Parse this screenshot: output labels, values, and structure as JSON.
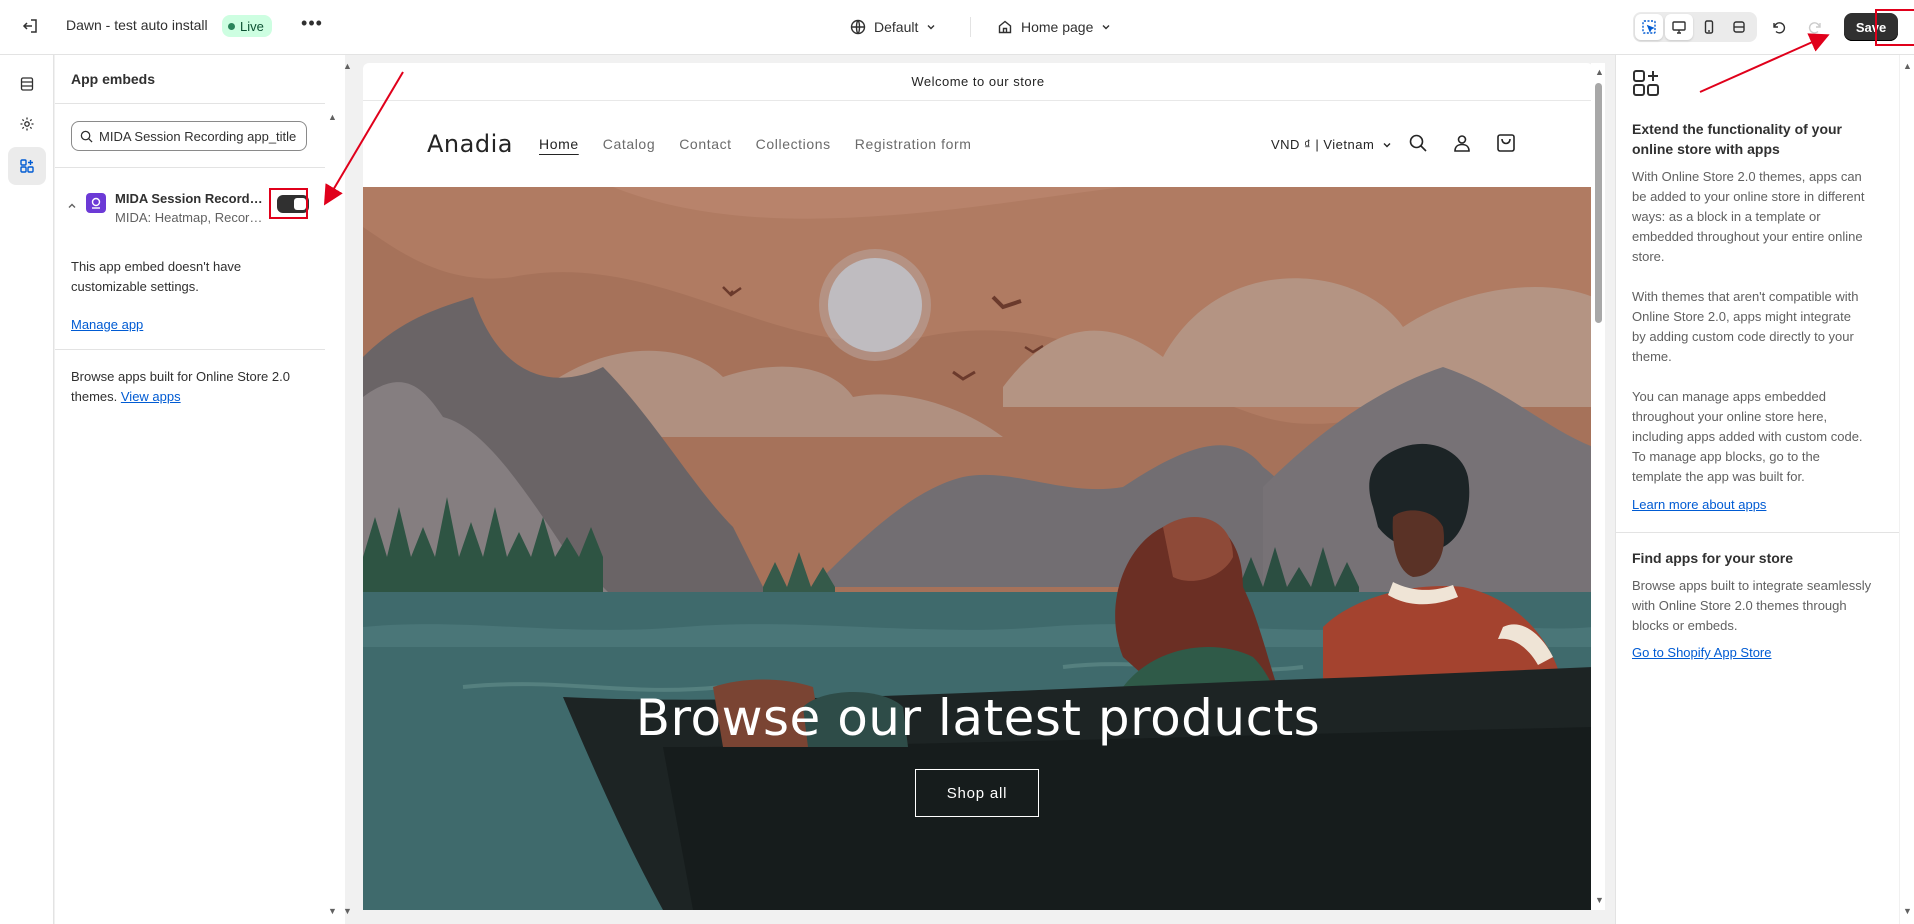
{
  "topbar": {
    "theme_name": "Dawn - test auto install",
    "status_badge": "Live",
    "more_label": "•••",
    "theme_selector": "Default",
    "page_selector": "Home page",
    "save_label": "Save"
  },
  "sidebar": {
    "title": "App embeds",
    "search_value": "MIDA Session Recording app_title",
    "app": {
      "name": "MIDA Session Recording",
      "subtitle": "MIDA: Heatmap, Recording",
      "enabled": true
    },
    "no_settings_text": "This app embed doesn't have customizable settings.",
    "manage_link": "Manage app",
    "browse_text": "Browse apps built for Online Store 2.0 themes.",
    "view_apps_link": "View apps"
  },
  "preview": {
    "announcement": "Welcome to our store",
    "store_logo": "Anadia",
    "nav": [
      "Home",
      "Catalog",
      "Contact",
      "Collections",
      "Registration form"
    ],
    "currency": "VND ₫ | Vietnam",
    "hero_title": "Browse our latest products",
    "hero_button": "Shop all"
  },
  "right_panel": {
    "heading1": "Extend the functionality of your online store with apps",
    "para1": "With Online Store 2.0 themes, apps can be added to your online store in different ways: as a block in a template or embedded throughout your entire online store.",
    "para2": "With themes that aren't compatible with Online Store 2.0, apps might integrate by adding custom code directly to your theme.",
    "para3": "You can manage apps embedded throughout your online store here, including apps added with custom code. To manage app blocks, go to the template the app was built for.",
    "learn_link": "Learn more about apps",
    "heading2": "Find apps for your store",
    "para4": "Browse apps built to integrate seamlessly with Online Store 2.0 themes through blocks or embeds.",
    "store_link": "Go to Shopify App Store"
  },
  "colors": {
    "annotation": "#e0001b",
    "link": "#005bd3",
    "save_bg": "#303030"
  }
}
